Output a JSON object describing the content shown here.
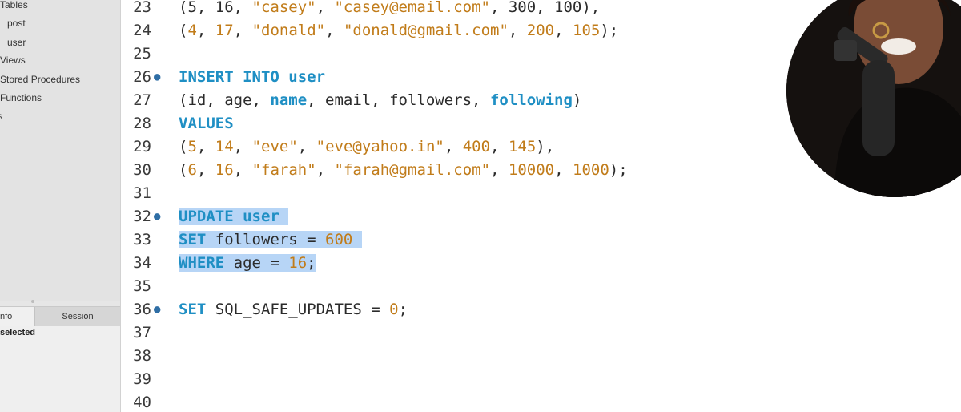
{
  "sidebar": {
    "tree_items": [
      "Tables",
      "post",
      "user",
      "Views",
      "Stored Procedures",
      "Functions",
      "s"
    ],
    "tabs": {
      "info": "nfo",
      "session": "Session"
    },
    "info_text": "selected"
  },
  "editor": {
    "lines": [
      {
        "num": "23",
        "tokens": [
          {
            "t": "(5, 16, ",
            "c": "plain"
          },
          {
            "t": "\"casey\"",
            "c": "str"
          },
          {
            "t": ", ",
            "c": "plain"
          },
          {
            "t": "\"casey@email.com\"",
            "c": "str"
          },
          {
            "t": ", 300, 100),",
            "c": "plain"
          }
        ]
      },
      {
        "num": "24",
        "tokens": [
          {
            "t": "(",
            "c": "plain"
          },
          {
            "t": "4",
            "c": "num"
          },
          {
            "t": ", ",
            "c": "plain"
          },
          {
            "t": "17",
            "c": "num"
          },
          {
            "t": ", ",
            "c": "plain"
          },
          {
            "t": "\"donald\"",
            "c": "str"
          },
          {
            "t": ", ",
            "c": "plain"
          },
          {
            "t": "\"donald@gmail.com\"",
            "c": "str"
          },
          {
            "t": ", ",
            "c": "plain"
          },
          {
            "t": "200",
            "c": "num"
          },
          {
            "t": ", ",
            "c": "plain"
          },
          {
            "t": "105",
            "c": "num"
          },
          {
            "t": ");",
            "c": "plain"
          }
        ]
      },
      {
        "num": "25",
        "tokens": []
      },
      {
        "num": "26",
        "dot": true,
        "tokens": [
          {
            "t": "INSERT INTO ",
            "c": "kw"
          },
          {
            "t": "user",
            "c": "tbl"
          }
        ]
      },
      {
        "num": "27",
        "tokens": [
          {
            "t": "(id, age, ",
            "c": "plain"
          },
          {
            "t": "name",
            "c": "kw"
          },
          {
            "t": ", email, followers, ",
            "c": "plain"
          },
          {
            "t": "following",
            "c": "kw"
          },
          {
            "t": ")",
            "c": "plain"
          }
        ]
      },
      {
        "num": "28",
        "tokens": [
          {
            "t": "VALUES",
            "c": "kw"
          }
        ]
      },
      {
        "num": "29",
        "tokens": [
          {
            "t": "(",
            "c": "plain"
          },
          {
            "t": "5",
            "c": "num"
          },
          {
            "t": ", ",
            "c": "plain"
          },
          {
            "t": "14",
            "c": "num"
          },
          {
            "t": ", ",
            "c": "plain"
          },
          {
            "t": "\"eve\"",
            "c": "str"
          },
          {
            "t": ", ",
            "c": "plain"
          },
          {
            "t": "\"eve@yahoo.in\"",
            "c": "str"
          },
          {
            "t": ", ",
            "c": "plain"
          },
          {
            "t": "400",
            "c": "num"
          },
          {
            "t": ", ",
            "c": "plain"
          },
          {
            "t": "145",
            "c": "num"
          },
          {
            "t": "),",
            "c": "plain"
          }
        ]
      },
      {
        "num": "30",
        "tokens": [
          {
            "t": "(",
            "c": "plain"
          },
          {
            "t": "6",
            "c": "num"
          },
          {
            "t": ", ",
            "c": "plain"
          },
          {
            "t": "16",
            "c": "num"
          },
          {
            "t": ", ",
            "c": "plain"
          },
          {
            "t": "\"farah\"",
            "c": "str"
          },
          {
            "t": ", ",
            "c": "plain"
          },
          {
            "t": "\"farah@gmail.com\"",
            "c": "str"
          },
          {
            "t": ", ",
            "c": "plain"
          },
          {
            "t": "10000",
            "c": "num"
          },
          {
            "t": ", ",
            "c": "plain"
          },
          {
            "t": "1000",
            "c": "num"
          },
          {
            "t": ");",
            "c": "plain"
          }
        ]
      },
      {
        "num": "31",
        "tokens": []
      },
      {
        "num": "32",
        "dot": true,
        "selected": true,
        "tokens": [
          {
            "t": "UPDATE ",
            "c": "kw"
          },
          {
            "t": "user",
            "c": "tbl"
          },
          {
            "t": " ",
            "c": "plain"
          }
        ]
      },
      {
        "num": "33",
        "selected": true,
        "tokens": [
          {
            "t": "SET",
            "c": "kw"
          },
          {
            "t": " followers = ",
            "c": "plain"
          },
          {
            "t": "600",
            "c": "num"
          },
          {
            "t": " ",
            "c": "plain"
          }
        ]
      },
      {
        "num": "34",
        "selected": true,
        "tokens": [
          {
            "t": "WHERE",
            "c": "kw"
          },
          {
            "t": " age = ",
            "c": "plain"
          },
          {
            "t": "16",
            "c": "num"
          },
          {
            "t": ";",
            "c": "plain"
          }
        ]
      },
      {
        "num": "35",
        "tokens": []
      },
      {
        "num": "36",
        "dot": true,
        "tokens": [
          {
            "t": "SET",
            "c": "kw"
          },
          {
            "t": " SQL_SAFE_UPDATES = ",
            "c": "plain"
          },
          {
            "t": "0",
            "c": "num"
          },
          {
            "t": ";",
            "c": "plain"
          }
        ]
      },
      {
        "num": "37",
        "tokens": []
      },
      {
        "num": "38",
        "tokens": []
      },
      {
        "num": "39",
        "tokens": []
      },
      {
        "num": "40",
        "tokens": []
      }
    ]
  },
  "colors": {
    "keyword": "#1f8fc4",
    "string": "#c17c1a",
    "selection": "#b7d5f6",
    "sidebar_bg": "#e3e3e3"
  },
  "icons": {
    "statement_marker": "bullet-dot-icon"
  }
}
